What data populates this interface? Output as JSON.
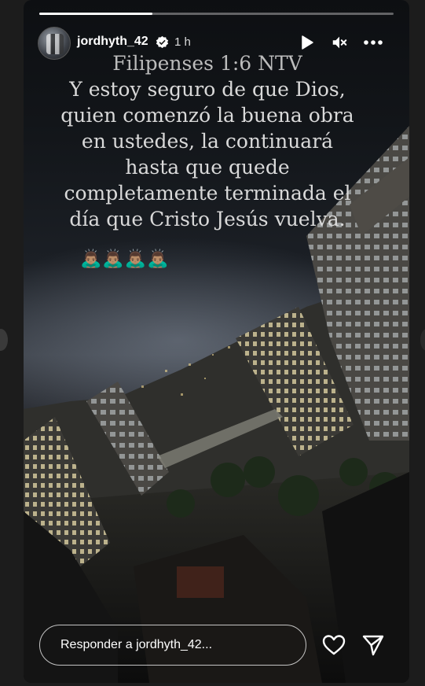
{
  "story": {
    "progress_fraction": 0.32,
    "username": "jordhyth_42",
    "time": "1 h",
    "verse_reference": "Filipenses 1:6 NTV",
    "verse_lines": [
      "Y estoy seguro de que Dios,",
      "quien comenzó la buena obra",
      "en ustedes, la continuará",
      "hasta que quede",
      "completamente terminada el",
      "día que Cristo Jesús vuelva."
    ],
    "emojis": "🙇🏽‍♂️🙇🏽‍♂️🙇🏽‍♂️🙇🏽‍♂️"
  },
  "icons": {
    "verified": "verified-badge-icon",
    "play": "play-icon",
    "mute": "mute-icon",
    "more": "more-options-icon",
    "heart": "heart-icon",
    "send": "send-icon"
  },
  "reply": {
    "placeholder": "Responder a jordhyth_42..."
  },
  "colors": {
    "background": "#1c1c1c",
    "text": "#ffffff",
    "verse_text": "#d9d9d9"
  }
}
